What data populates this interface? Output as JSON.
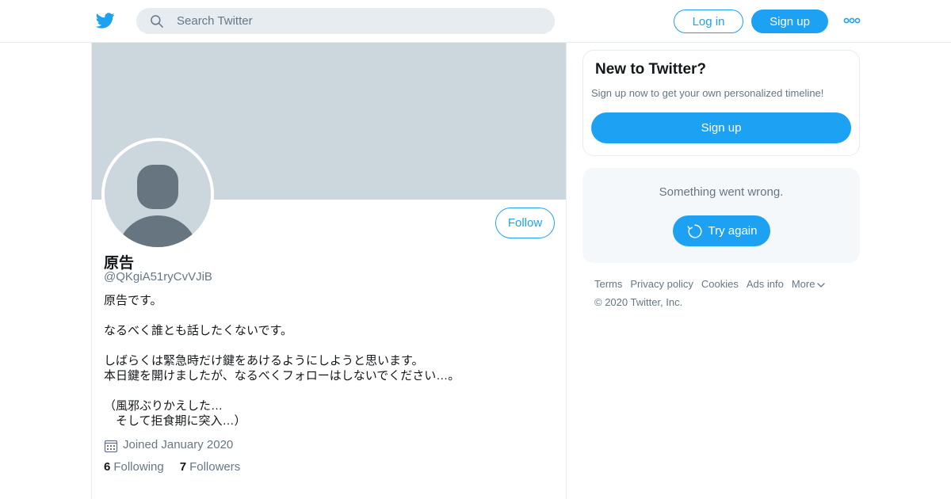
{
  "header": {
    "search_placeholder": "Search Twitter",
    "login_label": "Log in",
    "signup_label": "Sign up",
    "brand_color": "#1da1f2"
  },
  "profile": {
    "display_name": "原告",
    "handle": "@QKgiA51ryCvVJiB",
    "bio": "原告です。\n\nなるべく誰とも話したくないです。\n\nしばらくは緊急時だけ鍵をあけるようにしようと思います。\n本日鍵を開けましたが、なるべくフォローはしないでください…。\n\n（風邪ぶりかえした…\n　そして拒食期に突入…）",
    "follow_label": "Follow",
    "joined": "Joined January 2020",
    "following_count": "6",
    "following_label": "Following",
    "followers_count": "7",
    "followers_label": "Followers"
  },
  "new_to_twitter": {
    "title": "New to Twitter?",
    "subtitle": "Sign up now to get your own personalized timeline!",
    "signup_label": "Sign up"
  },
  "error_card": {
    "message": "Something went wrong.",
    "retry_label": "Try again"
  },
  "footer": {
    "links": [
      "Terms",
      "Privacy policy",
      "Cookies",
      "Ads info"
    ],
    "more_label": "More",
    "copyright": "© 2020 Twitter, Inc."
  },
  "icons": {
    "logo": "twitter-bird-icon",
    "search": "search-icon",
    "more": "more-dots-icon",
    "calendar": "calendar-icon",
    "retry": "refresh-icon",
    "chevron": "chevron-down-icon"
  }
}
